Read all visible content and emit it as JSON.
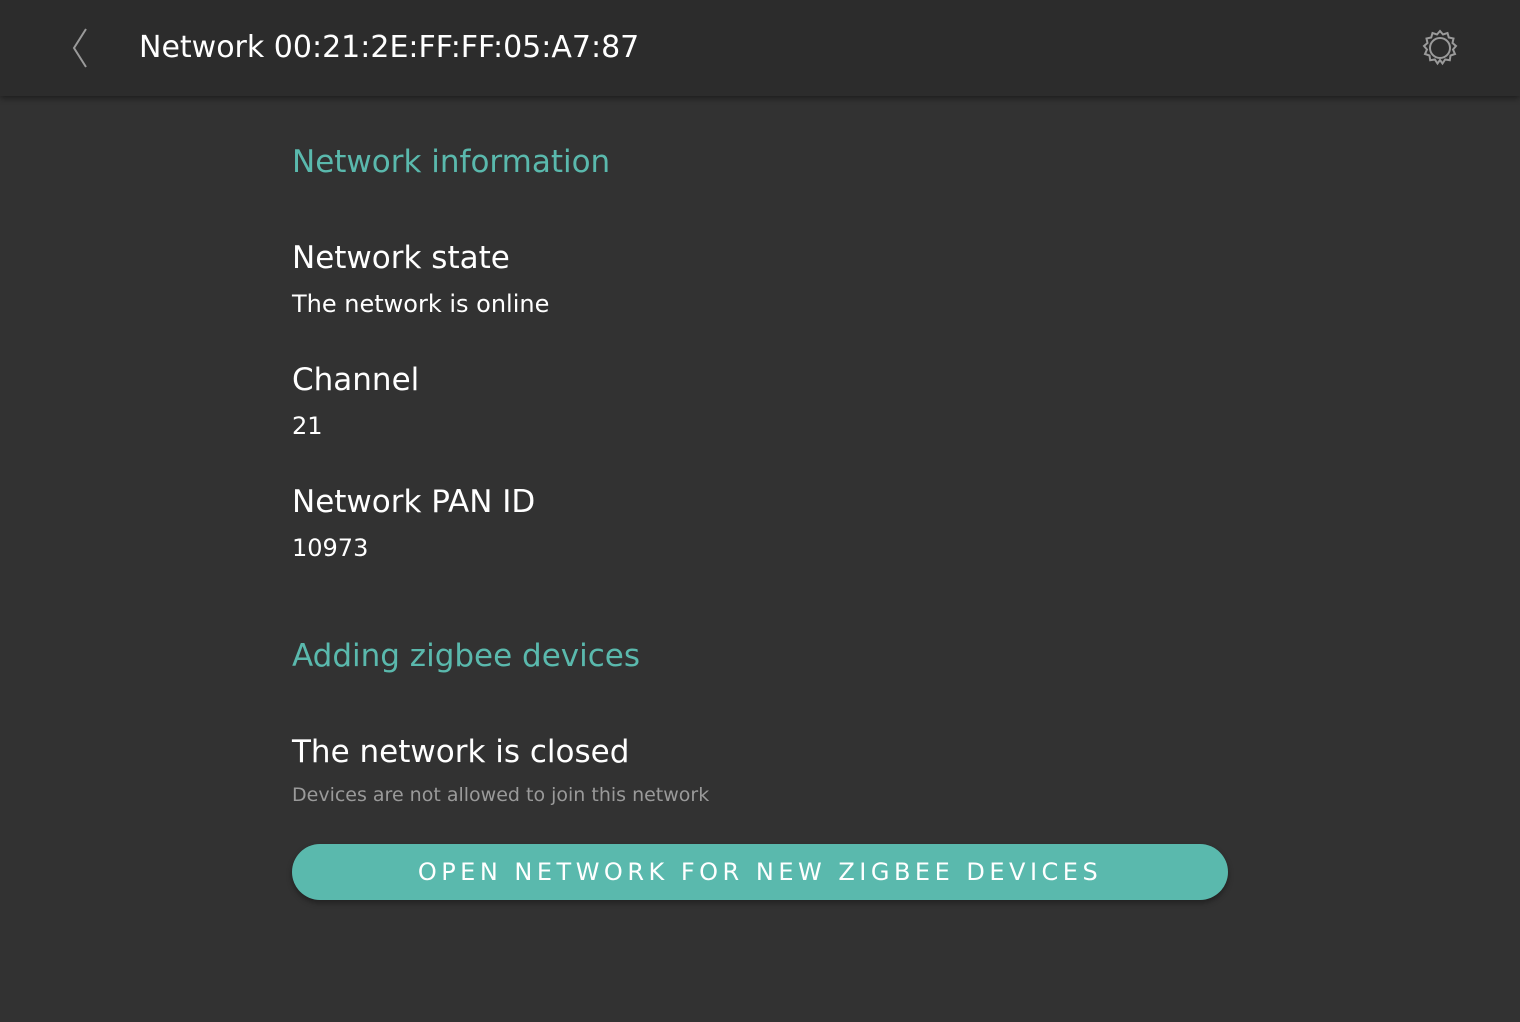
{
  "header": {
    "title": "Network 00:21:2E:FF:FF:05:A7:87",
    "back_icon": "chevron-left-icon",
    "settings_icon": "gear-icon"
  },
  "network_information": {
    "header": "Network information",
    "state": {
      "label": "Network state",
      "value": "The network is online"
    },
    "channel": {
      "label": "Channel",
      "value": "21"
    },
    "pan_id": {
      "label": "Network PAN ID",
      "value": "10973"
    }
  },
  "adding_devices": {
    "header": "Adding zigbee devices",
    "status_title": "The network is closed",
    "status_subtitle": "Devices are not allowed to join this network",
    "open_button_label": "OPEN NETWORK FOR NEW ZIGBEE DEVICES"
  },
  "colors": {
    "accent": "#5ab9ad",
    "background": "#323232",
    "header_background": "#2c2c2c",
    "secondary_text": "#9a9a9a"
  }
}
